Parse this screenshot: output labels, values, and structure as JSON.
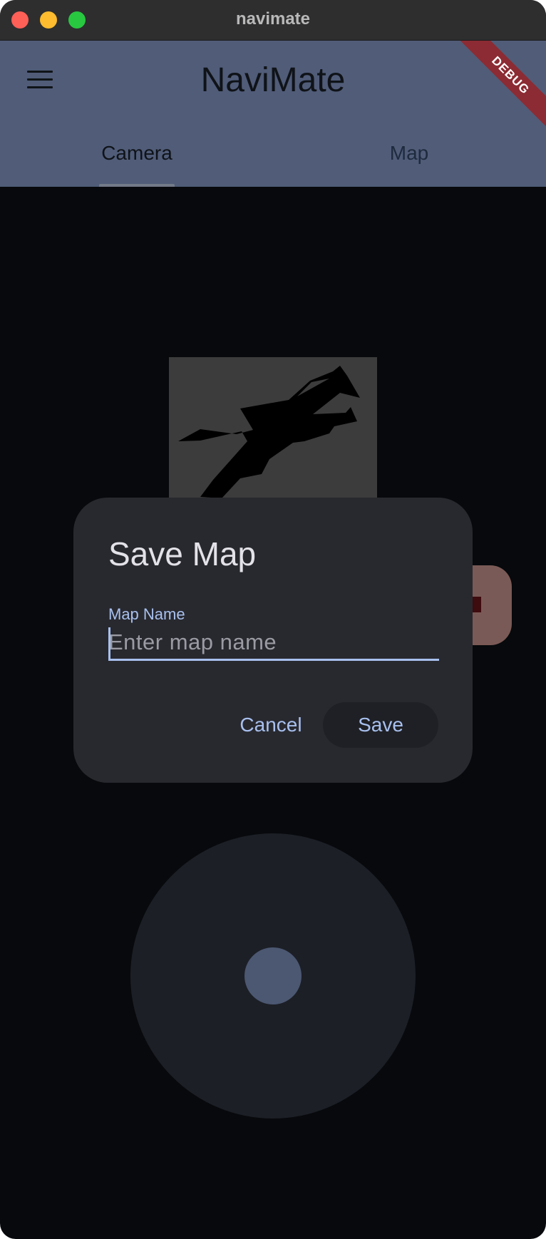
{
  "window": {
    "title": "navimate"
  },
  "appbar": {
    "title": "NaviMate",
    "debug_banner": "DEBUG",
    "tabs": [
      {
        "label": "Camera",
        "selected": true
      },
      {
        "label": "Map",
        "selected": false
      }
    ]
  },
  "dialog": {
    "title": "Save Map",
    "field_label": "Map Name",
    "field_placeholder": "Enter map name",
    "field_value": "",
    "cancel_label": "Cancel",
    "save_label": "Save"
  },
  "icons": {
    "menu": "hamburger-menu-icon"
  },
  "colors": {
    "appbar": "#505c78",
    "background": "#07090c",
    "dialog": "#28292f",
    "accent": "#a8c0ee",
    "debug": "#8c2b33"
  }
}
